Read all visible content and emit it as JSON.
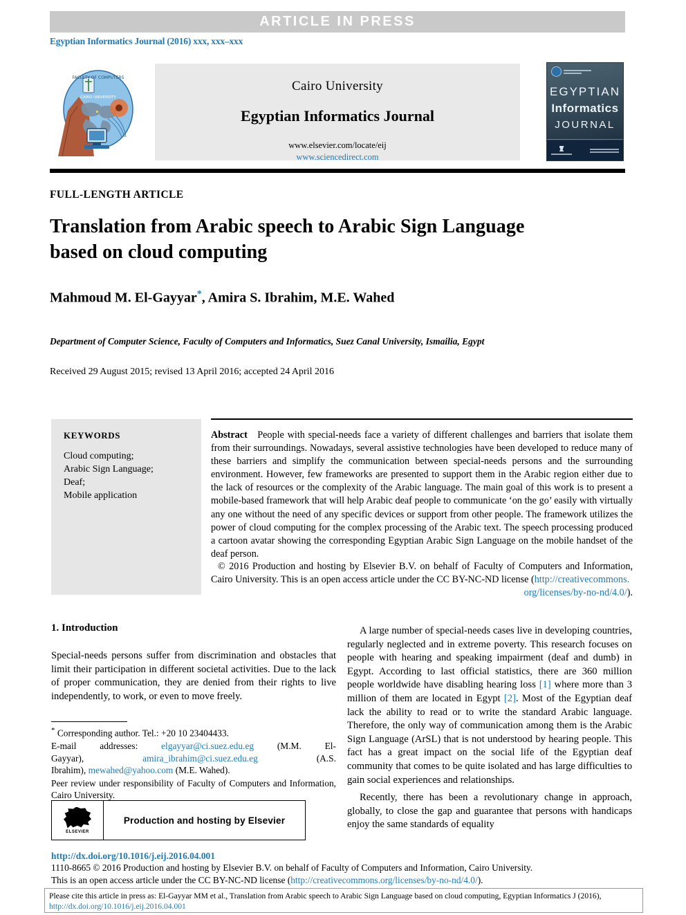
{
  "header": {
    "press_banner": "ARTICLE  IN  PRESS",
    "journal_reference": "Egyptian Informatics Journal (2016) xxx, xxx–xxx"
  },
  "masthead": {
    "university": "Cairo University",
    "journal_name": "Egyptian Informatics Journal",
    "url_elsevier": "www.elsevier.com/locate/eij",
    "url_sciencedirect": "www.sciencedirect.com",
    "logo_alt": "cairo-university-logo",
    "cover": {
      "line1": "EGYPTIAN",
      "line2": "Informatics",
      "line3": "JOURNAL"
    }
  },
  "article": {
    "kicker": "FULL-LENGTH ARTICLE",
    "title": "Translation from Arabic speech to Arabic Sign Language based on cloud computing",
    "authors": "Mahmoud M. El-Gayyar",
    "authors_rest": ", Amira S. Ibrahim, M.E. Wahed",
    "corresponding_marker": "*",
    "affiliation": "Department of Computer Science, Faculty of Computers and Informatics, Suez Canal University, Ismailia, Egypt",
    "dates": "Received 29 August 2015; revised 13 April 2016; accepted 24 April 2016"
  },
  "keywords": {
    "heading": "KEYWORDS",
    "items": [
      "Cloud computing;",
      "Arabic Sign Language;",
      "Deaf;",
      "Mobile application"
    ]
  },
  "abstract": {
    "label": "Abstract",
    "text": "People with special-needs face a variety of different challenges and barriers that isolate them from their surroundings. Nowadays, several assistive technologies have been developed to reduce many of these barriers and simplify the communication between special-needs persons and the surrounding environment. However, few frameworks are presented to support them in the Arabic region either due to the lack of resources or the complexity of the Arabic language. The main goal of this work is to present a mobile-based framework that will help Arabic deaf people to communicate ‘on the go’ easily with virtually any one without the need of any specific devices or support from other people. The framework utilizes the power of cloud computing for the complex processing of the Arabic text. The speech processing produced a cartoon avatar showing the corresponding Egyptian Arabic Sign Language on the mobile handset of the deaf person.",
    "copyright_text": "© 2016 Production and hosting by Elsevier B.V. on behalf of Faculty of Computers and Information, Cairo University. This is an open access article under the CC BY-NC-ND license (",
    "license_url_part1": "http://creativecommons.",
    "license_url_part2": "org/licenses/by-no-nd/4.0/",
    "copyright_tail": ")."
  },
  "body": {
    "section_heading": "1. Introduction",
    "left_paragraph": "Special-needs persons suffer from discrimination and obstacles that limit their participation in different societal activities. Due to the lack of proper communication, they are denied from their rights to live independently, to work, or even to move freely.",
    "right_paragraph_1_a": "A large number of special-needs cases live in developing countries, regularly neglected and in extreme poverty. This research focuses on people with hearing and speaking impairment (deaf and dumb) in Egypt. According to last official statistics, there are 360 million people worldwide have disabling hearing loss ",
    "citation_1": "[1]",
    "right_paragraph_1_b": " where more than 3 million of them are located in Egypt ",
    "citation_2": "[2]",
    "right_paragraph_1_c": ". Most of the Egyptian deaf lack the ability to read or to write the standard Arabic language. Therefore, the only way of communication among them is the Arabic Sign Language (ArSL) that is not understood by hearing people. This fact has a great impact on the social life of the Egyptian deaf community that comes to be quite isolated and has large difficulties to gain social experiences and relationships.",
    "right_paragraph_2": "Recently, there has been a revolutionary change in approach, globally, to close the gap and guarantee that persons with handicaps enjoy the same standards of equality"
  },
  "footnotes": {
    "corresponding": "Corresponding author. Tel.: +20 10 23404433.",
    "email_label": "E-mail addresses:",
    "email_1": "elgayyar@ci.suez.edu.eg",
    "email_1_owner": "(M.M. El-Gayyar),",
    "email_2": "amira_ibrahim@ci.suez.edu.eg",
    "email_2_owner": "(A.S. Ibrahim),",
    "email_3": "mewahed@yahoo.com",
    "email_3_owner": "(M.E. Wahed).",
    "peer_review": "Peer review under responsibility of Faculty of Computers and Information, Cairo University."
  },
  "elsevier_box": {
    "label": "Production and hosting by Elsevier",
    "logo_word": "ELSEVIER"
  },
  "footer": {
    "doi": "http://dx.doi.org/10.1016/j.eij.2016.04.001",
    "issn_line": "1110-8665 © 2016 Production and hosting by Elsevier B.V. on behalf of Faculty of Computers and Information, Cairo University.",
    "license_line_prefix": "This is an open access article under the CC BY-NC-ND license (",
    "license_line_url": "http://creativecommons.org/licenses/by-no-nd/4.0/",
    "license_line_suffix": ")."
  },
  "cite_box": {
    "text_prefix": "Please cite this article in press as: El-Gayyar MM et al., Translation from Arabic speech to Arabic Sign Language based on cloud computing, Egyptian Informatics J (2016), ",
    "doi": "http://dx.doi.org/10.1016/j.eij.2016.04.001"
  },
  "colors": {
    "link": "#1f7bb6",
    "banner_bg": "#c9c9c9",
    "masthead_bg": "#e9e9e9",
    "keywords_bg": "#e6e6e6"
  }
}
